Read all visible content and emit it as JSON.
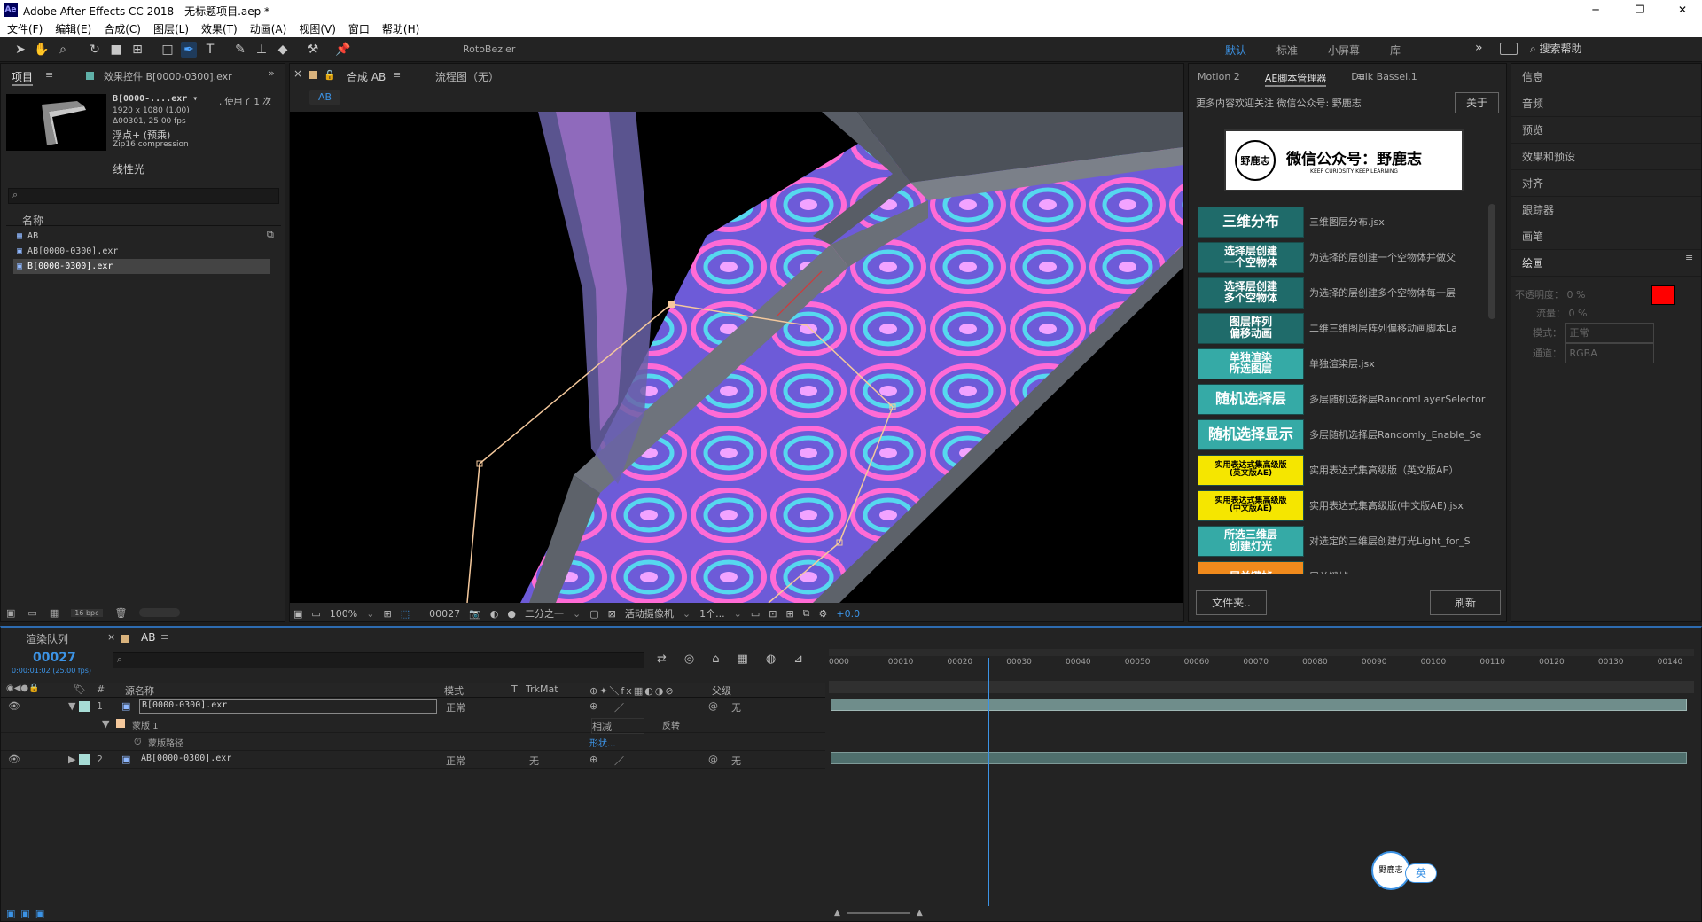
{
  "window": {
    "title": "Adobe After Effects CC 2018 - 无标题项目.aep *",
    "app_icon": "Ae"
  },
  "menu": [
    "文件(F)",
    "编辑(E)",
    "合成(C)",
    "图层(L)",
    "效果(T)",
    "动画(A)",
    "视图(V)",
    "窗口",
    "帮助(H)"
  ],
  "toolbar": {
    "rotobezier_label": "RotoBezier"
  },
  "workspaces": {
    "items": [
      "默认",
      "标准",
      "小屏幕",
      "库"
    ],
    "current": "默认",
    "search_placeholder": "搜索帮助"
  },
  "project_panel": {
    "tab_project": "项目",
    "tab_effects": "效果控件 B[0000-0300].exr",
    "footage_name": "B[0000-....exr ▾",
    "used_count": ", 使用了 1 次",
    "dimensions": "1920 x 1080 (1.00)",
    "duration": "Δ00301, 25.00 fps",
    "float_info": "浮点+ (预乘)",
    "compression": "Zip16 compression",
    "linear_label": "线性光",
    "search_placeholder": "",
    "column_name": "名称",
    "items": [
      "AB",
      "AB[0000-0300].exr",
      "B[0000-0300].exr"
    ],
    "bpc": "16 bpc"
  },
  "viewer": {
    "tab_comp": "合成 AB",
    "tab_flow": "流程图（无）",
    "comp_chip": "AB",
    "zoom": "100%",
    "timecode": "00027",
    "resolution": "二分之一",
    "camera": "活动摄像机",
    "views": "1个...",
    "exposure": "+0.0"
  },
  "scripts_panel": {
    "tabs": [
      "Motion 2",
      "AE脚本管理器",
      "Duik Bassel.1"
    ],
    "active_tab": "AE脚本管理器",
    "promo_text": "更多内容欢迎关注 微信公众号: 野鹿志",
    "about_button": "关于",
    "banner_title": "微信公众号：野鹿志",
    "banner_sub": "KEEP CURIOSITY KEEP LEARNING",
    "banner_logo_text": "野鹿志",
    "scripts": [
      {
        "label": "三维分布",
        "desc": "三维图层分布.jsx",
        "color": "#1f6b6a",
        "big": true
      },
      {
        "label": "选择层创建\n一个空物体",
        "desc": "为选择的层创建一个空物体并做父",
        "color": "#1f6b6a"
      },
      {
        "label": "选择层创建\n多个空物体",
        "desc": "为选择的层创建多个空物体每一层",
        "color": "#1f6b6a"
      },
      {
        "label": "图层阵列\n偏移动画",
        "desc": "二维三维图层阵列偏移动画脚本La",
        "color": "#1f6b6a"
      },
      {
        "label": "单独渲染\n所选图层",
        "desc": "单独渲染层.jsx",
        "color": "#35aaa6"
      },
      {
        "label": "随机选择层",
        "desc": "多层随机选择层RandomLayerSelector",
        "color": "#35aaa6",
        "big": true
      },
      {
        "label": "随机选择显示",
        "desc": "多层随机选择层Randomly_Enable_Se",
        "color": "#35aaa6",
        "big": true
      },
      {
        "label": "实用表达式集高级版\n(英文版AE)",
        "desc": "实用表达式集高级版（英文版AE）",
        "color": "#f5e600",
        "dark": true
      },
      {
        "label": "实用表达式集高级版\n(中文版AE)",
        "desc": "实用表达式集高级版(中文版AE).jsx",
        "color": "#f5e600",
        "dark": true
      },
      {
        "label": "所选三维层\n创建灯光",
        "desc": "对选定的三维层创建灯光Light_for_S",
        "color": "#35aaa6"
      },
      {
        "label": "层关键帧",
        "desc": "层关键帧",
        "color": "#f08a1c"
      }
    ],
    "folder_button": "文件夹..",
    "refresh_button": "刷新"
  },
  "right_panel": {
    "items": [
      "信息",
      "音频",
      "预览",
      "效果和预设",
      "对齐",
      "跟踪器",
      "画笔",
      "绘画"
    ],
    "paint": {
      "opacity_label": "不透明度：",
      "opacity_value": "0 %",
      "flow_label": "流量：",
      "flow_value": "0 %",
      "mode_label": "模式：",
      "mode_value": "正常",
      "channel_label": "通道：",
      "channel_value": "RGBA"
    },
    "fg_color": "#ff0000",
    "bg_color": "#ffffff"
  },
  "timeline": {
    "tab_render": "渲染队列",
    "tab_comp": "AB",
    "timecode": "00027",
    "timecode_sub": "0:00:01:02 (25.00 fps)",
    "headers": {
      "source_name": "源名称",
      "mode": "模式",
      "t": "T",
      "trkmat": "TrkMat",
      "parent": "父级"
    },
    "layers": [
      {
        "num": "1",
        "name": "B[0000-0300].exr",
        "mode": "正常",
        "trkmat": "",
        "parent": "无"
      },
      {
        "num": "2",
        "name": "AB[0000-0300].exr",
        "mode": "正常",
        "trkmat": "无",
        "parent": "无"
      }
    ],
    "mask": {
      "name": "蒙版 1",
      "mode": "相减",
      "inverted": "反转",
      "path_label": "蒙版路径",
      "path_value": "形状..."
    },
    "ruler": [
      "0000",
      "00010",
      "00020",
      "00030",
      "00040",
      "00050",
      "00060",
      "00070",
      "00080",
      "00090",
      "00100",
      "00110",
      "00120",
      "00130",
      "00140"
    ],
    "playhead_frame": 27,
    "total_frames": 144,
    "ime_label": "英"
  },
  "colors": {
    "accent": "#3c93e5",
    "teal": "#35aaa6",
    "dark_teal": "#1f6b6a",
    "yellow": "#f5e600",
    "orange": "#f08a1c",
    "layer_bar": "#6f8d8b"
  }
}
